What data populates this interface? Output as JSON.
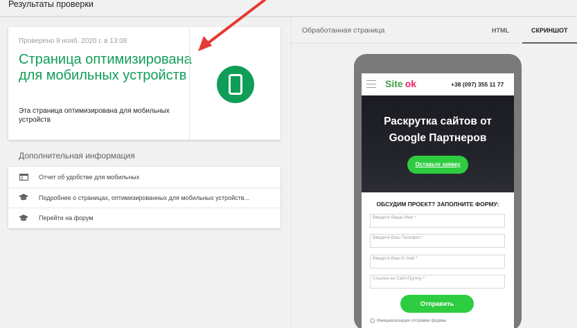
{
  "header": {
    "title": "Результаты проверки"
  },
  "result_card": {
    "checked_text": "Проверено 9 нояб. 2020 г. в 13:08",
    "headline": "Страница оптимизирована для мобильных устройств",
    "subtext": "Эта страница оптимизирована для мобильных устройств",
    "status_color": "#0f9d58",
    "status_icon": "smartphone-icon"
  },
  "additional": {
    "heading": "Дополнительная информация",
    "items": [
      {
        "label": "Отчет об удобстве для мобильных",
        "icon": "report-icon"
      },
      {
        "label": "Подробнее о страницах, оптимизированных для мобильных устройств...",
        "icon": "school-icon"
      },
      {
        "label": "Перейти на форум",
        "icon": "school-icon"
      }
    ]
  },
  "right_panel": {
    "label": "Обработанная страница",
    "tabs": [
      {
        "label": "HTML",
        "active": false
      },
      {
        "label": "СКРИНШОТ",
        "active": true
      }
    ]
  },
  "preview": {
    "logo_site": "Site",
    "logo_ok": "ok",
    "phone": "+38 (097) 355 11 77",
    "hero_title": "Раскрутка сайтов от Google Партнеров",
    "hero_cta": "Оставьте заявку",
    "form_title": "ОБСУДИМ ПРОЕКТ? ЗАПОЛНИТЕ ФОРМУ:",
    "fields": [
      "Введите Ваше Имя *",
      "Введите Ваш Телефон *",
      "Введите Ваш E-mail *",
      "Ссылка на Сайт/Группу *"
    ],
    "submit": "Отправить",
    "init_text": "Инициализация отправки формы",
    "accent_color": "#2ecc40"
  }
}
